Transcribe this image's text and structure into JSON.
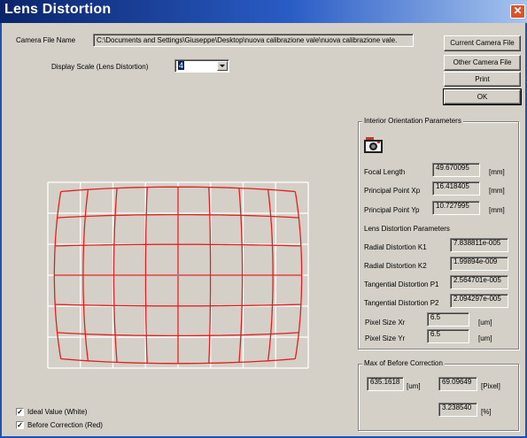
{
  "window": {
    "title": "Lens Distortion",
    "close_glyph": "✕"
  },
  "camera_file": {
    "label": "Camera File Name",
    "path": "C:\\Documents and Settings\\Giuseppe\\Desktop\\nuova calibrazione vale\\nuova calibrazione vale."
  },
  "display_scale": {
    "label": "Display Scale (Lens Distortion)",
    "value": "4"
  },
  "buttons": {
    "current_camera_file": "Current Camera File",
    "other_camera_file": "Other Camera File",
    "print": "Print",
    "ok": "OK"
  },
  "interior": {
    "group_label": "Interior Orientation Parameters",
    "focal_length": {
      "label": "Focal Length",
      "value": "49.670095",
      "unit": "[mm]"
    },
    "principal_xp": {
      "label": "Principal Point Xp",
      "value": "16.418405",
      "unit": "[mm]"
    },
    "principal_yp": {
      "label": "Principal Point Yp",
      "value": "10.727995",
      "unit": "[mm]"
    },
    "lens_distortion_heading": "Lens Distortion Parameters",
    "k1": {
      "label": "Radial Distortion K1",
      "value": "7.838811e-005"
    },
    "k2": {
      "label": "Radial Distortion K2",
      "value": "1.99894e-009"
    },
    "p1": {
      "label": "Tangential Distortion P1",
      "value": "2.564701e-005"
    },
    "p2": {
      "label": "Tangential Distortion P2",
      "value": "2.094297e-005"
    },
    "pixel_xr": {
      "label": "Pixel Size Xr",
      "value": "6.5",
      "unit": "[um]"
    },
    "pixel_yr": {
      "label": "Pixel Size Yr",
      "value": "6.5",
      "unit": "[um]"
    }
  },
  "max_correction": {
    "group_label": "Max of Before Correction",
    "um_value": "635.1618",
    "um_unit": "[um]",
    "pixel_value": "69.09649",
    "pixel_unit": "[Pixel]",
    "percent_value": "3.238540",
    "percent_unit": "[%]"
  },
  "checkboxes": {
    "ideal_label": "Ideal Value (White)",
    "ideal_checked": true,
    "before_label": "Before Correction (Red)",
    "before_checked": true,
    "check_glyph": "✓"
  },
  "plot": {
    "colors": {
      "ideal": "#ffffff",
      "before": "#e02020",
      "center": "#6a8fd0"
    },
    "grid_columns": 8,
    "grid_rows": 6,
    "barrel_bulge": 0.05
  }
}
